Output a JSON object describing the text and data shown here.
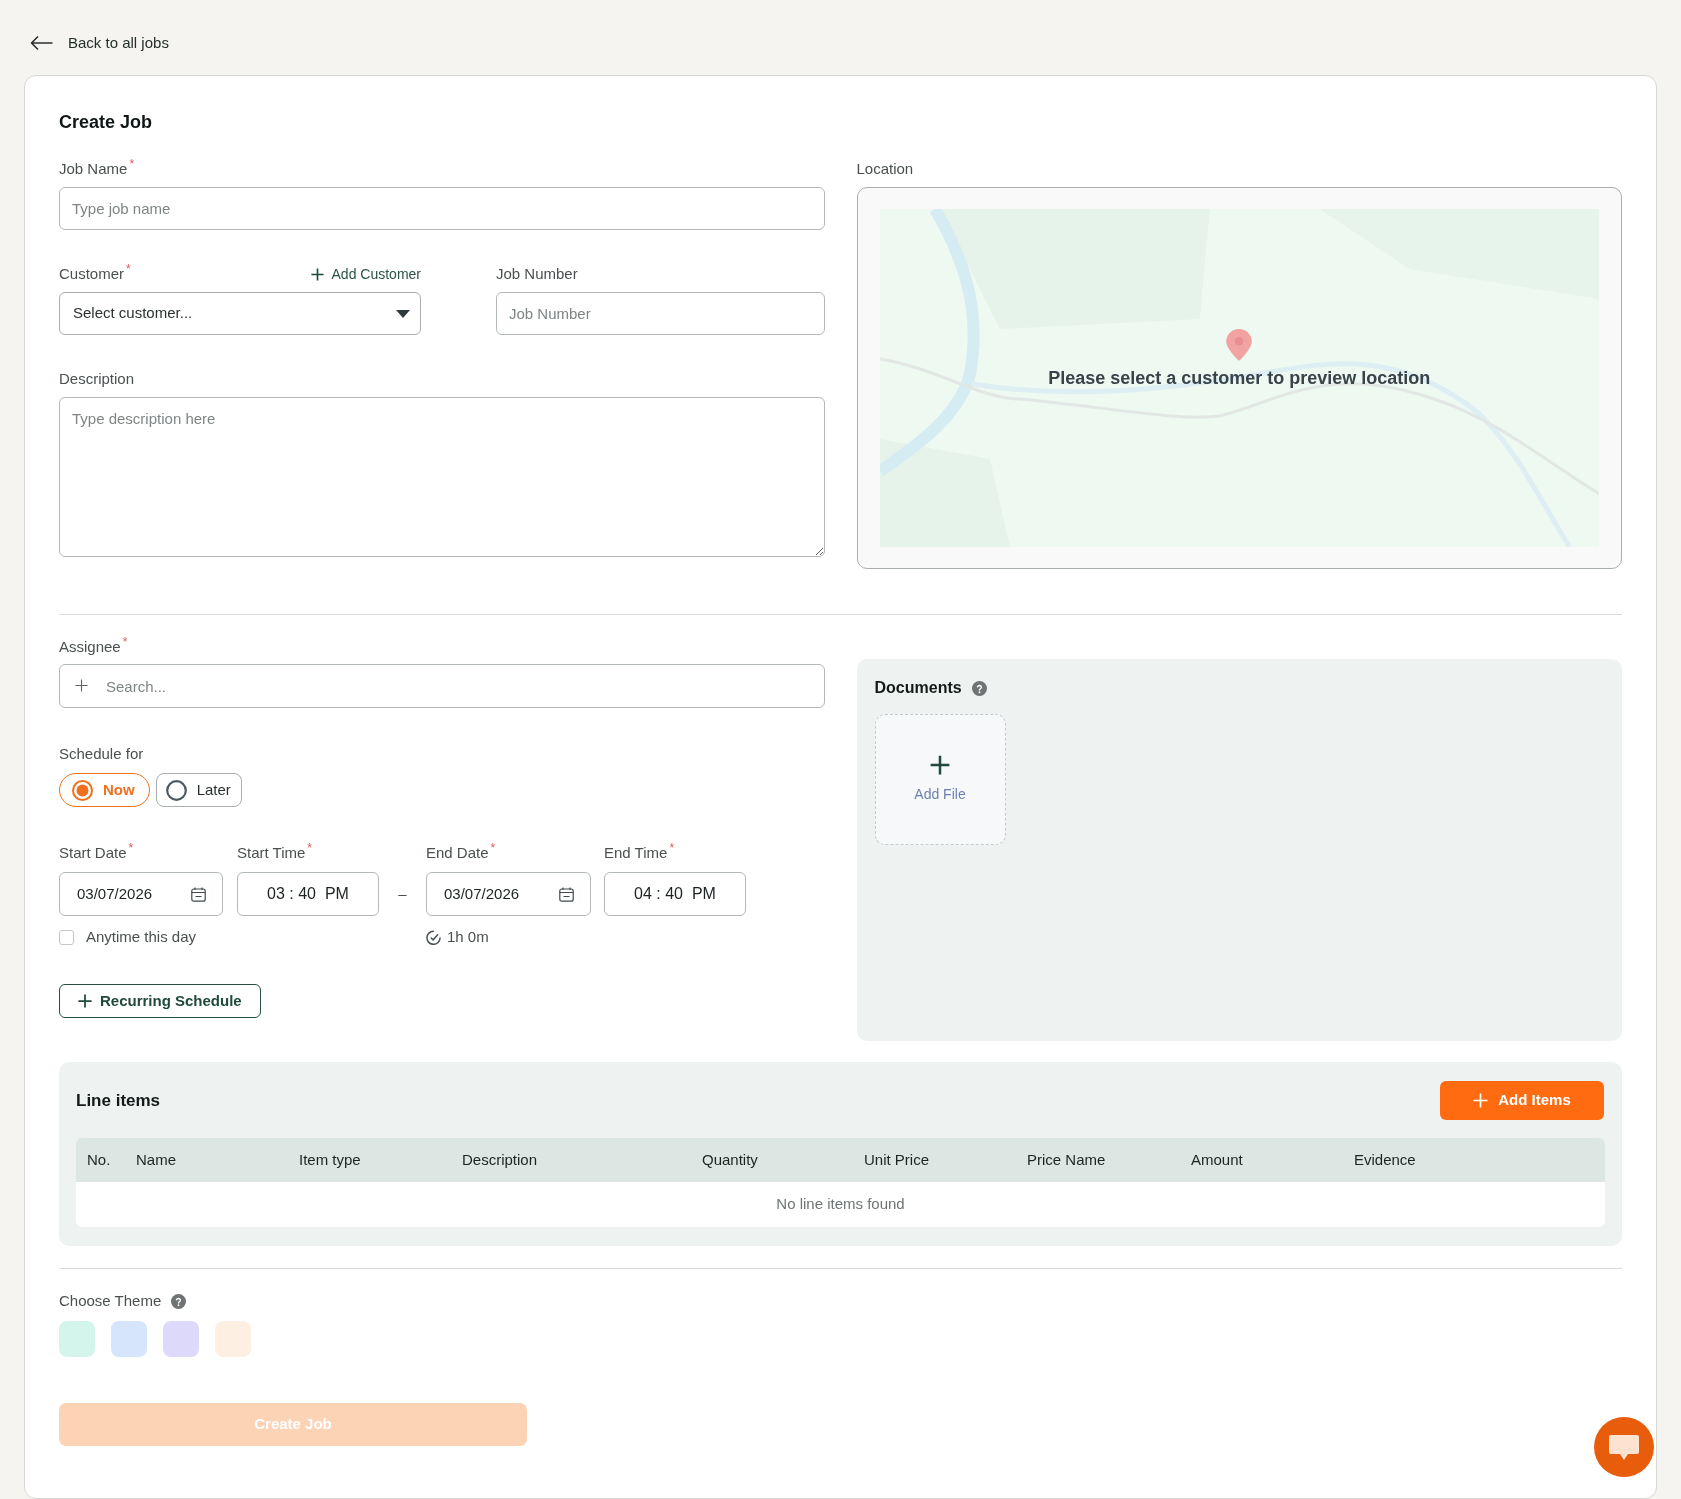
{
  "back_link": {
    "label": "Back to all jobs"
  },
  "title": "Create Job",
  "job_name": {
    "label": "Job Name",
    "mark": "*",
    "placeholder": "Type job name"
  },
  "customer": {
    "label": "Customer",
    "mark": "*",
    "add_link": "Add Customer",
    "placeholder": "Select customer..."
  },
  "job_number": {
    "label": "Job Number",
    "placeholder": "Job Number"
  },
  "description": {
    "label": "Description",
    "placeholder": "Type description here"
  },
  "location": {
    "label": "Location",
    "message": "Please select a customer to preview location"
  },
  "assignee": {
    "label": "Assignee",
    "mark": "*",
    "placeholder": "Search..."
  },
  "schedule": {
    "label": "Schedule for",
    "options": [
      {
        "label": "Now",
        "selected": true
      },
      {
        "label": "Later",
        "selected": false
      }
    ]
  },
  "start_date": {
    "label": "Start Date",
    "mark": "*",
    "value": "03/07/2026"
  },
  "start_time": {
    "label": "Start Time",
    "mark": "*",
    "value": "03 : 40  PM"
  },
  "range_separator": "–",
  "end_date": {
    "label": "End Date",
    "mark": "*",
    "value": "03/07/2026"
  },
  "end_time": {
    "label": "End Time",
    "mark": "*",
    "value": "04 : 40  PM"
  },
  "anytime": {
    "label": "Anytime this day",
    "checked": false
  },
  "duration": "1h 0m",
  "recurring_button": {
    "label": "Recurring Schedule"
  },
  "documents": {
    "title": "Documents",
    "add_file": "Add File"
  },
  "line_items": {
    "title": "Line items",
    "add_button": "Add Items",
    "columns": [
      "No.",
      "Name",
      "Item type",
      "Description",
      "Quantity",
      "Unit Price",
      "Price Name",
      "Amount",
      "Evidence"
    ],
    "empty_message": "No line items found"
  },
  "theme": {
    "label": "Choose Theme",
    "swatches": [
      {
        "color": "#d4f5ec",
        "selected": false
      },
      {
        "color": "#d6e4fc",
        "selected": false
      },
      {
        "color": "#dcd9fb",
        "selected": false
      },
      {
        "color": "#fdf0e2",
        "selected": false
      }
    ]
  },
  "submit": {
    "label": "Create Job",
    "disabled": true
  }
}
